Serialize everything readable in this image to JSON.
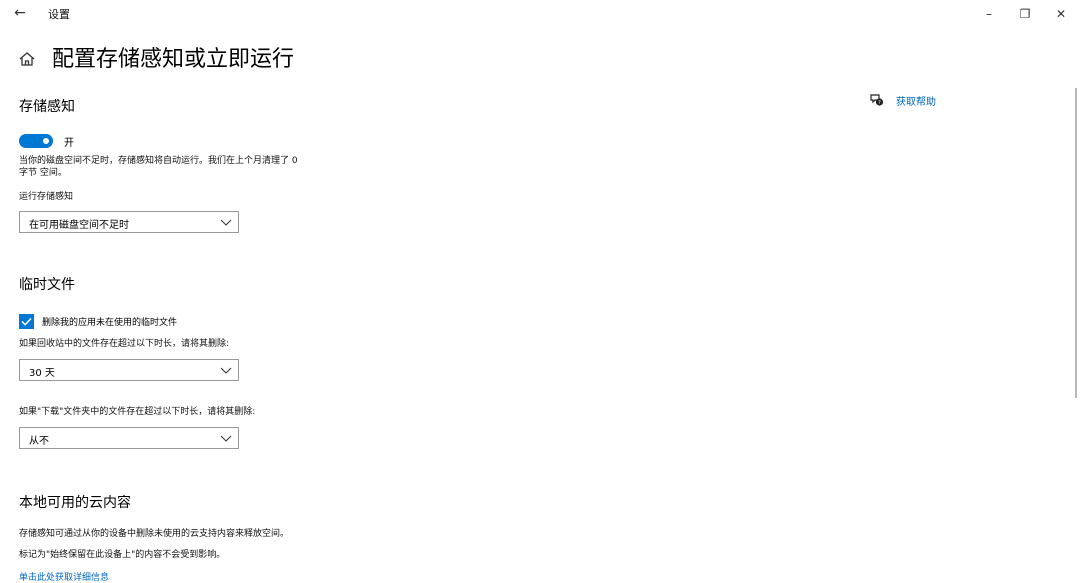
{
  "window": {
    "title": "设置",
    "minimize_glyph": "–",
    "restore_glyph": "❐",
    "close_glyph": "✕",
    "back_glyph": "←"
  },
  "page": {
    "title": "配置存储感知或立即运行"
  },
  "help": {
    "label": "获取帮助",
    "icon": "help-chat-icon"
  },
  "storage_sense": {
    "heading": "存储感知",
    "toggle_state": "开",
    "toggle_on": true,
    "desc_line1": "当你的磁盘空间不足时，存储感知将自动运行。我们在上个月清理了 0",
    "desc_line2": "字节 空间。",
    "run_label": "运行存储感知",
    "run_value": "在可用磁盘空间不足时"
  },
  "temp_files": {
    "heading": "临时文件",
    "checkbox_label": "删除我的应用未在使用的临时文件",
    "checkbox_checked": true,
    "recycle_label": "如果回收站中的文件存在超过以下时长，请将其删除:",
    "recycle_value": "30 天",
    "downloads_label": "如果\"下载\"文件夹中的文件存在超过以下时长，请将其删除:",
    "downloads_value": "从不"
  },
  "cloud": {
    "heading": "本地可用的云内容",
    "desc1": "存储感知可通过从你的设备中删除未使用的云支持内容来释放空间。",
    "desc2": "标记为\"始终保留在此设备上\"的内容不会受到影响。",
    "learn_more": "单击此处获取详细信息"
  },
  "colors": {
    "accent": "#0078d4",
    "link": "#0067c0"
  }
}
